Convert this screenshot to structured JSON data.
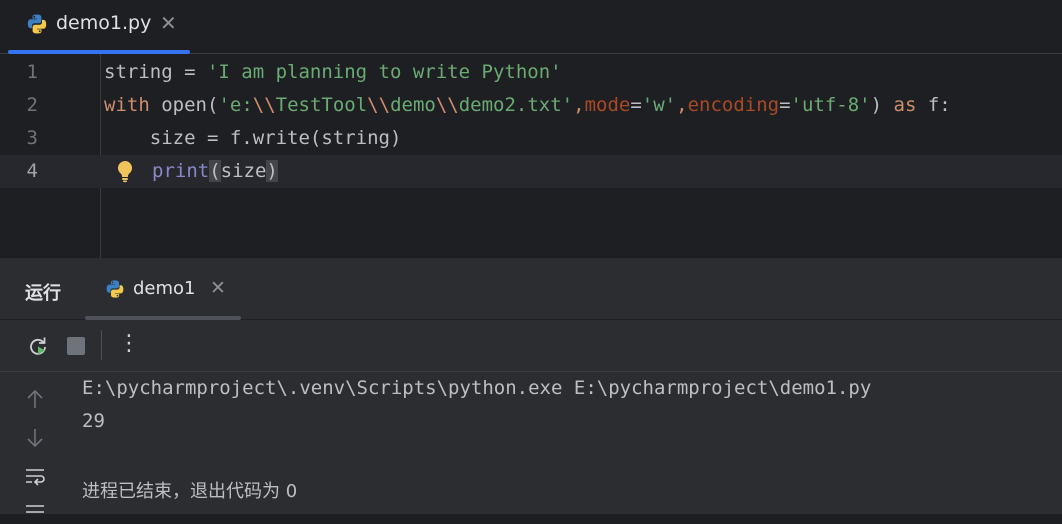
{
  "editor_tab": {
    "filename": "demo1.py",
    "icon": "python-icon"
  },
  "editor": {
    "lines": [
      {
        "n": "1",
        "var": "string",
        "op": " = ",
        "str": "'I am planning to write Python'"
      },
      {
        "n": "2",
        "kw_with": "with",
        "fn_open": "open",
        "p1": "'e:",
        "esc1": "\\\\",
        "p2": "TestTool",
        "esc2": "\\\\",
        "p3": "demo",
        "esc3": "\\\\",
        "p4": "demo2.txt'",
        "comma1": ",",
        "mode_kw": "mode",
        "mode_eq": "=",
        "mode_val": "'w'",
        "comma2": ",",
        "enc_kw": "encoding",
        "enc_eq": "=",
        "enc_val": "'utf-8'",
        "close": ") ",
        "kw_as": "as",
        "tail": " f:"
      },
      {
        "n": "3",
        "code": "    size = f.write(string)"
      },
      {
        "n": "4",
        "builtin": "print",
        "paren_open": "(",
        "arg": "size",
        "paren_close": ")"
      }
    ]
  },
  "run_panel": {
    "label": "运行",
    "tab_name": "demo1",
    "tab_icon": "python-icon"
  },
  "toolbar": {
    "rerun": "rerun-icon",
    "stop": "stop-icon",
    "more": "⋮"
  },
  "console": {
    "command": "E:\\pycharmproject\\.venv\\Scripts\\python.exe E:\\pycharmproject\\demo1.py",
    "result": "29",
    "exit_message": "进程已结束，退出代码为 0"
  },
  "colors": {
    "accent": "#3574f0",
    "string": "#6aab73",
    "keyword": "#cf8e6d",
    "param": "#aa4926",
    "builtin": "#8888c6"
  }
}
